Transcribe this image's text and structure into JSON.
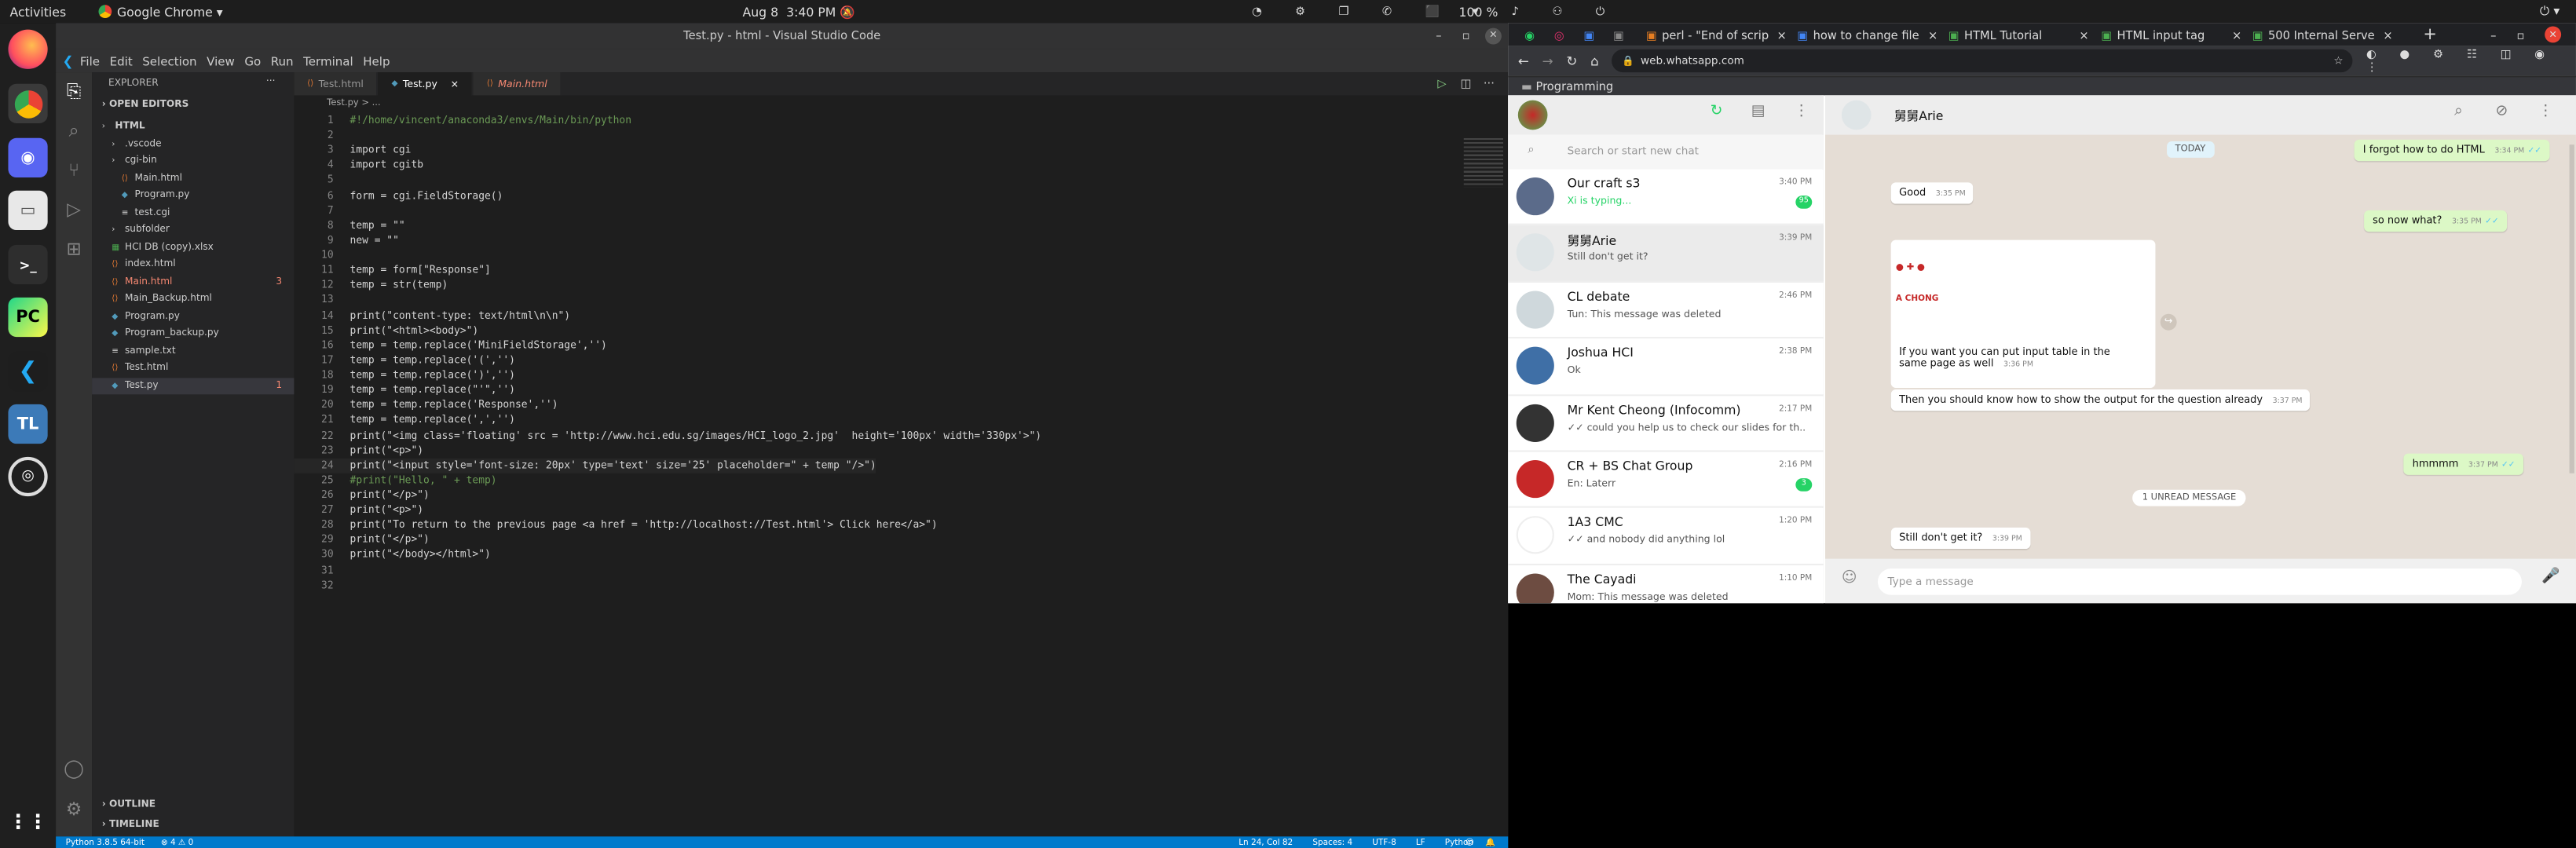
{
  "topbar": {
    "activities": "Activities",
    "app": "Google Chrome",
    "date": "Aug 8",
    "time": "3:40 PM",
    "battery": "100 %"
  },
  "dock": [
    "firefox-icon",
    "chrome-icon",
    "discord-icon",
    "files-icon",
    "terminal-icon",
    "pycharm-icon",
    "vscode-icon",
    "texlive-icon",
    "ubuntu-software-icon",
    "apps-grid-icon"
  ],
  "vscode": {
    "window_title": "Test.py - html - Visual Studio Code",
    "menu": [
      "File",
      "Edit",
      "Selection",
      "View",
      "Go",
      "Run",
      "Terminal",
      "Help"
    ],
    "explorer_title": "EXPLORER",
    "open_editors": "OPEN EDITORS",
    "tree": [
      {
        "label": "HTML",
        "indent": 0,
        "bold": true
      },
      {
        "label": ".vscode",
        "indent": 1
      },
      {
        "label": "cgi-bin",
        "indent": 1
      },
      {
        "label": "Main.html",
        "indent": 2
      },
      {
        "label": "Program.py",
        "indent": 2
      },
      {
        "label": "test.cgi",
        "indent": 2
      },
      {
        "label": "subfolder",
        "indent": 1
      },
      {
        "label": "HCI DB (copy).xlsx",
        "indent": 1
      },
      {
        "label": "index.html",
        "indent": 1
      },
      {
        "label": "Main.html",
        "indent": 1,
        "badge": "3",
        "error": true
      },
      {
        "label": "Main_Backup.html",
        "indent": 1
      },
      {
        "label": "Program.py",
        "indent": 1
      },
      {
        "label": "Program_backup.py",
        "indent": 1
      },
      {
        "label": "sample.txt",
        "indent": 1
      },
      {
        "label": "Test.html",
        "indent": 1
      },
      {
        "label": "Test.py",
        "indent": 1,
        "badge": "1",
        "selected": true
      }
    ],
    "outline": "OUTLINE",
    "timeline": "TIMELINE",
    "tabs": [
      {
        "label": "Test.html",
        "active": false
      },
      {
        "label": "Test.py",
        "active": true
      },
      {
        "label": "Main.html",
        "active": false
      }
    ],
    "breadcrumb": "Test.py > ...",
    "code": [
      "#!/home/vincent/anaconda3/envs/Main/bin/python",
      "",
      "import cgi",
      "import cgitb",
      "",
      "form = cgi.FieldStorage()",
      "",
      "temp = \"\"",
      "new = \"\"",
      "",
      "temp = form[\"Response\"]",
      "temp = str(temp)",
      "",
      "print(\"content-type: text/html\\n\\n\")",
      "print(\"<html><body>\")",
      "temp = temp.replace('MiniFieldStorage','')",
      "temp = temp.replace('(','')",
      "temp = temp.replace(')','')",
      "temp = temp.replace(\"'\",'')",
      "temp = temp.replace('Response','')",
      "temp = temp.replace(',','')",
      "print(\"<img class='floating' src = 'http://www.hci.edu.sg/images/HCI_logo_2.jpg'  height='100px' width='330px'>\")",
      "print(\"<p>\")",
      "print(\"<input style='font-size: 20px' type='text' size='25' placeholder=\" + temp \"/>\")",
      "#print(\"Hello, \" + temp)",
      "print(\"</p>\")",
      "print(\"<p>\")",
      "print(\"To return to the previous page <a href = 'http://localhost://Test.html'> Click here</a>\")",
      "print(\"</p>\")",
      "print(\"</body></html>\")",
      "",
      ""
    ],
    "status_left": "Python 3.8.5 64-bit",
    "status_problems": "⊗ 4 ⚠ 0",
    "status_right": [
      "Ln 24, Col 82",
      "Spaces: 4",
      "UTF-8",
      "LF",
      "Python"
    ]
  },
  "chrome": {
    "tabs": [
      "perl - \"End of scrip",
      "how to change file",
      "HTML Tutorial",
      "HTML input tag",
      "500 Internal Serve"
    ],
    "url": "web.whatsapp.com",
    "bookmark": "Programming"
  },
  "whatsapp": {
    "search_placeholder": "Search or start new chat",
    "chats": [
      {
        "name": "Our craft s3",
        "msg": "Xi is typing...",
        "time": "3:40 PM",
        "badge": "95",
        "typing": true,
        "avatar": "#5b6b8a"
      },
      {
        "name": "舅舅Arie",
        "msg": "Still don't get it?",
        "time": "3:39 PM",
        "selected": true,
        "avatar": "#dfe5e7"
      },
      {
        "name": "CL debate",
        "msg": "Tun: This message was deleted",
        "time": "2:46 PM",
        "avatar": "#cfd8dc"
      },
      {
        "name": "Joshua HCI",
        "msg": "Ok",
        "time": "2:38 PM",
        "avatar": "#3f6fa6"
      },
      {
        "name": "Mr Kent Cheong (Infocomm)",
        "msg": "✓✓ could you help us to check our slides for th...",
        "time": "2:17 PM",
        "avatar": "#333333"
      },
      {
        "name": "CR + BS Chat Group",
        "msg": "En: Laterr",
        "time": "2:16 PM",
        "badge": "3",
        "avatar": "#c62828"
      },
      {
        "name": "1A3 CMC",
        "msg": "✓✓ and nobody did anything lol",
        "time": "1:20 PM",
        "avatar": "#ffffff"
      },
      {
        "name": "The Cayadi",
        "msg": "Mom: This message was deleted",
        "time": "1:10 PM",
        "avatar": "#6d4c41"
      }
    ],
    "contact": "舅舅Arie",
    "today": "TODAY",
    "unread": "1 UNREAD MESSAGE",
    "messages": [
      {
        "text": "I forgot how to do HTML",
        "time": "3:34 PM",
        "out": true
      },
      {
        "text": "Good",
        "time": "3:35 PM",
        "out": false
      },
      {
        "text": "so now what?",
        "time": "3:35 PM",
        "out": true
      },
      {
        "text": "If you want you can put input table in the same page as well",
        "time": "3:36 PM",
        "out": false
      },
      {
        "text": "Then you should know how to show the output for the question already",
        "time": "3:37 PM",
        "out": false
      },
      {
        "text": "hmmmm",
        "time": "3:37 PM",
        "out": true
      },
      {
        "text": "Still don't get it?",
        "time": "3:39 PM",
        "out": false
      }
    ],
    "image_caption": "A CHONG",
    "input_placeholder": "Type a message"
  }
}
